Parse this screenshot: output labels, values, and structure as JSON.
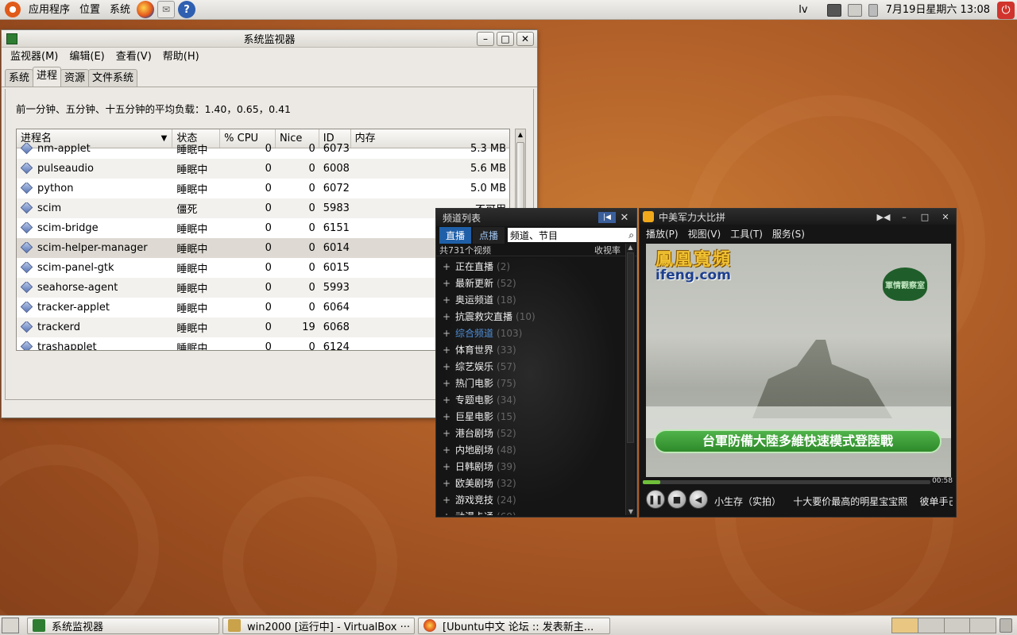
{
  "top_panel": {
    "menus": [
      "应用程序",
      "位置",
      "系统"
    ],
    "user": "lv",
    "datetime": "7月19日星期六 13:08"
  },
  "sysmon": {
    "title": "系统监视器",
    "menus": [
      "监视器(M)",
      "编辑(E)",
      "查看(V)",
      "帮助(H)"
    ],
    "tabs": [
      "系统",
      "进程",
      "资源",
      "文件系统"
    ],
    "active_tab": "进程",
    "load_avg": "前一分钟、五分钟、十五分钟的平均负载：1.40，0.65，0.41",
    "columns": [
      "进程名",
      "状态",
      "% CPU",
      "Nice",
      "ID",
      "内存"
    ],
    "rows": [
      {
        "name": "nm-applet",
        "state": "睡眠中",
        "cpu": "0",
        "nice": "0",
        "id": "6073",
        "mem": "5.3 MB"
      },
      {
        "name": "pulseaudio",
        "state": "睡眠中",
        "cpu": "0",
        "nice": "0",
        "id": "6008",
        "mem": "5.6 MB"
      },
      {
        "name": "python",
        "state": "睡眠中",
        "cpu": "0",
        "nice": "0",
        "id": "6072",
        "mem": "5.0 MB"
      },
      {
        "name": "scim",
        "state": "僵死",
        "cpu": "0",
        "nice": "0",
        "id": "5983",
        "mem": "不可用"
      },
      {
        "name": "scim-bridge",
        "state": "睡眠中",
        "cpu": "0",
        "nice": "0",
        "id": "6151",
        "mem": ""
      },
      {
        "name": "scim-helper-manager",
        "state": "睡眠中",
        "cpu": "0",
        "nice": "0",
        "id": "6014",
        "mem": ""
      },
      {
        "name": "scim-panel-gtk",
        "state": "睡眠中",
        "cpu": "0",
        "nice": "0",
        "id": "6015",
        "mem": ""
      },
      {
        "name": "seahorse-agent",
        "state": "睡眠中",
        "cpu": "0",
        "nice": "0",
        "id": "5993",
        "mem": ""
      },
      {
        "name": "tracker-applet",
        "state": "睡眠中",
        "cpu": "0",
        "nice": "0",
        "id": "6064",
        "mem": ""
      },
      {
        "name": "trackerd",
        "state": "睡眠中",
        "cpu": "0",
        "nice": "19",
        "id": "6068",
        "mem": ""
      },
      {
        "name": "trashapplet",
        "state": "睡眠中",
        "cpu": "0",
        "nice": "0",
        "id": "6124",
        "mem": ""
      }
    ]
  },
  "channel_list": {
    "title": "频道列表",
    "tab_live": "直播",
    "tab_vod": "点播",
    "search_value": "频道、节目",
    "total": "共731个视频",
    "sort": "收视率",
    "items": [
      {
        "name": "正在直播",
        "count": "(2)"
      },
      {
        "name": "最新更新",
        "count": "(52)"
      },
      {
        "name": "奥运频道",
        "count": "(18)"
      },
      {
        "name": "抗震救灾直播",
        "count": "(10)"
      },
      {
        "name": "综合频道",
        "count": "(103)"
      },
      {
        "name": "体育世界",
        "count": "(33)"
      },
      {
        "name": "综艺娱乐",
        "count": "(57)"
      },
      {
        "name": "热门电影",
        "count": "(75)"
      },
      {
        "name": "专题电影",
        "count": "(34)"
      },
      {
        "name": "巨星电影",
        "count": "(15)"
      },
      {
        "name": "港台剧场",
        "count": "(52)"
      },
      {
        "name": "内地剧场",
        "count": "(48)"
      },
      {
        "name": "日韩剧场",
        "count": "(39)"
      },
      {
        "name": "欧美剧场",
        "count": "(32)"
      },
      {
        "name": "游戏竞技",
        "count": "(24)"
      },
      {
        "name": "动漫卡通",
        "count": "(69)"
      }
    ],
    "highlight": "综合频道"
  },
  "player": {
    "title": "中美军力大比拼",
    "menus": [
      "播放(P)",
      "视图(V)",
      "工具(T)",
      "服务(S)"
    ],
    "logo_text": "鳳凰寬頻",
    "logo_url": "ifeng.com",
    "corner_logo": "軍情觀察室",
    "subtitle": "台軍防備大陸多維快速模式登陸戰",
    "time": "00:58",
    "progress": 0.06,
    "ticker": "小生存（实拍）    十大要价最高的明星宝宝照    彼单手己"
  },
  "taskbar": {
    "tasks": [
      "系统监视器",
      "win2000 [运行中] - VirtualBox ···",
      "[Ubuntu中文 论坛 :: 发表新主..."
    ]
  },
  "colors": {
    "desktop": "#b4622a",
    "player_bg": "#141414",
    "accent_blue": "#1f5fa8",
    "subtitle_green": "#2f8a2a"
  }
}
